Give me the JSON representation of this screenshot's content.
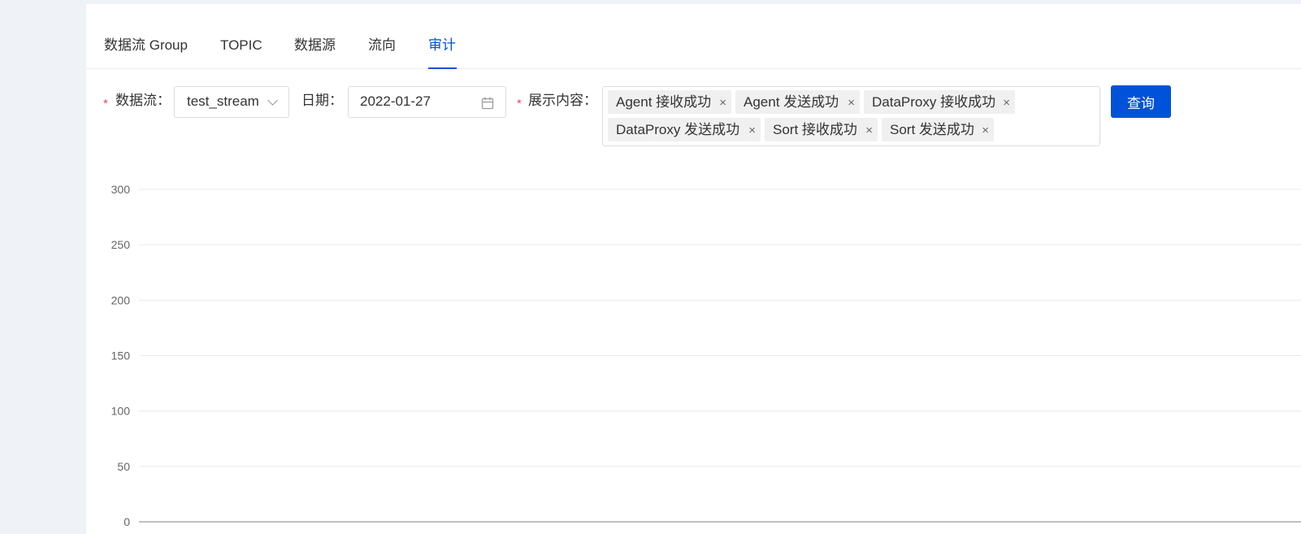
{
  "tabs": [
    {
      "label": "数据流 Group",
      "active": false
    },
    {
      "label": "TOPIC",
      "active": false
    },
    {
      "label": "数据源",
      "active": false
    },
    {
      "label": "流向",
      "active": false
    },
    {
      "label": "审计",
      "active": true
    }
  ],
  "form": {
    "stream_label": "数据流：",
    "stream_value": "test_stream",
    "date_label": "日期：",
    "date_value": "2022-01-27",
    "content_label": "展示内容：",
    "content_tags": [
      "Agent 接收成功",
      "Agent 发送成功",
      "DataProxy 接收成功",
      "DataProxy 发送成功",
      "Sort 接收成功",
      "Sort 发送成功"
    ],
    "required_mark": "*",
    "query_label": "查询"
  },
  "colors": {
    "accent": "#0052d9",
    "required": "#e34d59",
    "background": "#eff2f7",
    "gridline": "#e7eaf0"
  },
  "chart_data": {
    "type": "line",
    "title": "",
    "xlabel": "",
    "ylabel": "",
    "ylim": [
      0,
      300
    ],
    "y_ticks": [
      "300",
      "250",
      "200",
      "150",
      "100",
      "50",
      "0"
    ],
    "grid": true,
    "series": []
  }
}
